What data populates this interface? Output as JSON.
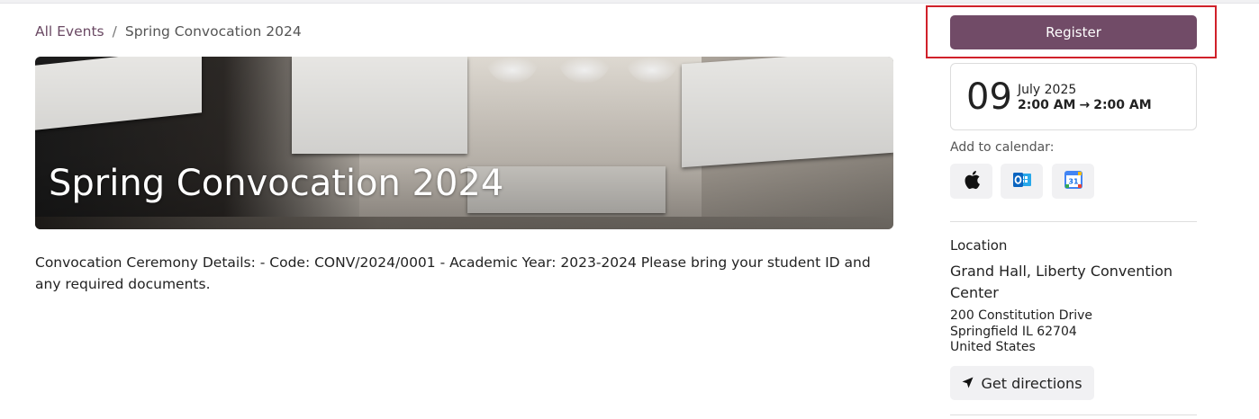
{
  "breadcrumb": {
    "parent": "All Events",
    "separator": "/",
    "current": "Spring Convocation 2024"
  },
  "event": {
    "title": "Spring Convocation 2024",
    "description": "Convocation Ceremony Details: - Code: CONV/2024/0001 - Academic Year: 2023-2024 Please bring your student ID and any required documents."
  },
  "register": {
    "label": "Register",
    "color": "#714b67"
  },
  "date": {
    "day": "09",
    "month_year": "July 2025",
    "start_time": "2:00 AM",
    "arrow": "→",
    "end_time": "2:00 AM"
  },
  "calendar": {
    "label": "Add to calendar:",
    "buttons": [
      {
        "icon": "apple-icon"
      },
      {
        "icon": "outlook-icon"
      },
      {
        "icon": "google-calendar-icon"
      }
    ]
  },
  "location": {
    "heading": "Location",
    "name": "Grand Hall, Liberty Convention Center",
    "address_lines": [
      "200 Constitution Drive",
      "Springfield IL 62704",
      "United States"
    ],
    "directions_label": "Get directions"
  },
  "colors": {
    "accent": "#714b67",
    "highlight_outline": "#d0212a"
  }
}
